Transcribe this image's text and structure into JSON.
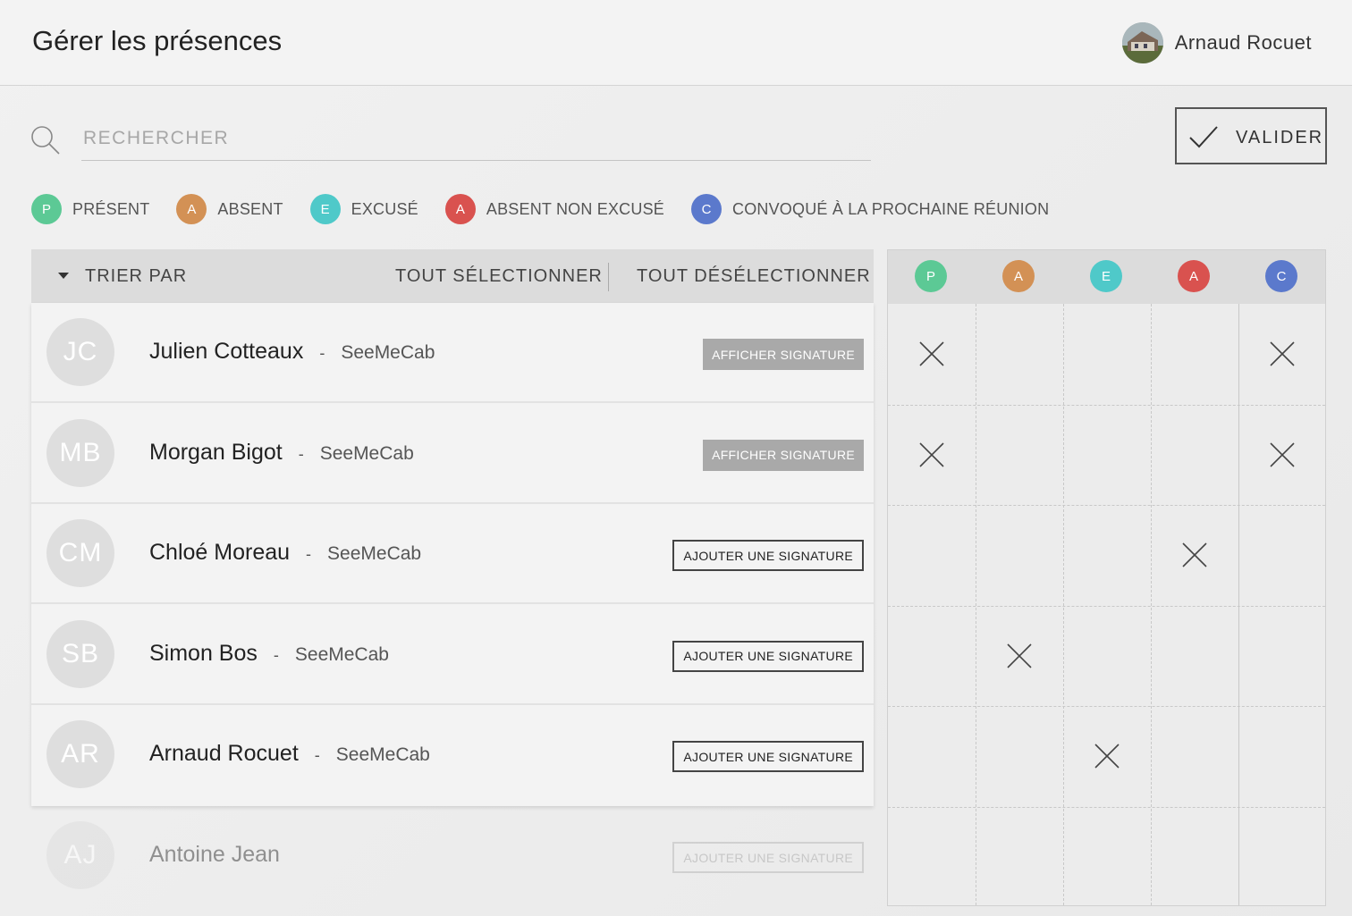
{
  "header": {
    "title": "Gérer les présences",
    "user_name": "Arnaud Rocuet"
  },
  "search": {
    "placeholder": "RECHERCHER"
  },
  "validate_label": "VALIDER",
  "legend": [
    {
      "letter": "P",
      "label": "PRÉSENT",
      "color": "#5cc995"
    },
    {
      "letter": "A",
      "label": "ABSENT",
      "color": "#d39155"
    },
    {
      "letter": "E",
      "label": "EXCUSÉ",
      "color": "#4fc9c9"
    },
    {
      "letter": "A",
      "label": "ABSENT NON EXCUSÉ",
      "color": "#d9524f"
    },
    {
      "letter": "C",
      "label": "CONVOQUÉ À LA PROCHAINE RÉUNION",
      "color": "#5b79cc"
    }
  ],
  "list_header": {
    "sort_label": "TRIER PAR",
    "select_all": "TOUT SÉLECTIONNER",
    "deselect_all": "TOUT DÉSÉLECTIONNER"
  },
  "participants": [
    {
      "initials": "JC",
      "name": "Julien Cotteaux",
      "separator": "-",
      "org": "SeeMeCab",
      "button": "AFFICHER SIGNATURE",
      "button_type": "show",
      "marks": [
        true,
        false,
        false,
        false,
        true
      ]
    },
    {
      "initials": "MB",
      "name": "Morgan Bigot",
      "separator": "-",
      "org": "SeeMeCab",
      "button": "AFFICHER SIGNATURE",
      "button_type": "show",
      "marks": [
        true,
        false,
        false,
        false,
        true
      ]
    },
    {
      "initials": "CM",
      "name": "Chloé Moreau",
      "separator": "-",
      "org": "SeeMeCab",
      "button": "AJOUTER UNE SIGNATURE",
      "button_type": "add",
      "marks": [
        false,
        false,
        false,
        true,
        false
      ]
    },
    {
      "initials": "SB",
      "name": "Simon Bos",
      "separator": "-",
      "org": "SeeMeCab",
      "button": "AJOUTER UNE SIGNATURE",
      "button_type": "add",
      "marks": [
        false,
        true,
        false,
        false,
        false
      ]
    },
    {
      "initials": "AR",
      "name": "Arnaud Rocuet",
      "separator": "-",
      "org": "SeeMeCab",
      "button": "AJOUTER UNE SIGNATURE",
      "button_type": "add",
      "marks": [
        false,
        false,
        true,
        false,
        false
      ]
    },
    {
      "initials": "AJ",
      "name": "Antoine Jean",
      "separator": "",
      "org": "",
      "button": "AJOUTER UNE SIGNATURE",
      "button_type": "add",
      "marks": [
        false,
        false,
        false,
        false,
        false
      ]
    }
  ]
}
